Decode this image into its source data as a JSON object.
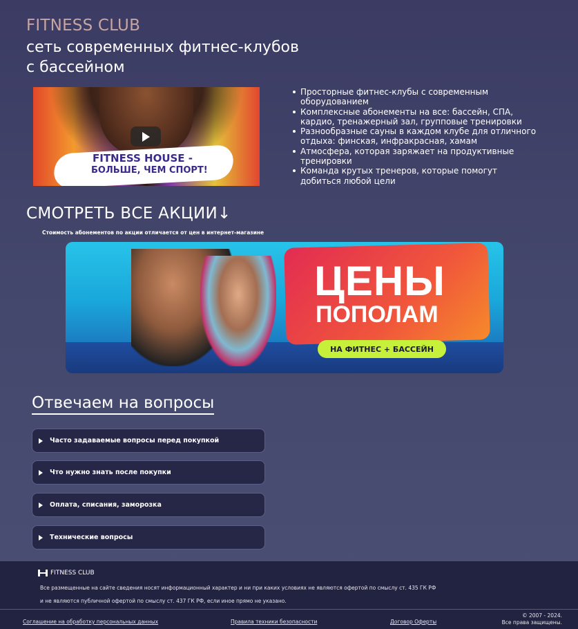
{
  "header": {
    "brand": "FITNESS CLUB",
    "headline_line1": "сеть современных фитнес-клубов",
    "headline_line2": "с бассейном"
  },
  "video": {
    "caption_line1": "FITNESS HOUSE -",
    "caption_line2": "БОЛЬШЕ, ЧЕМ СПОРТ!"
  },
  "benefits": [
    "Просторные фитнес-клубы с современным оборудованием",
    "Комплексные абонементы на все: бассейн, СПА, кардио, тренажерный зал, групповые тренировки",
    "Разнообразные сауны в каждом клубе для отличного отдыха: финская, инфракрасная, хамам",
    "Атмосфера, которая заряжает на продуктивные тренировки",
    "Команда крутых тренеров, которые помогут добиться любой цели"
  ],
  "promo": {
    "title": "СМОТРЕТЬ ВСЕ АКЦИИ↓",
    "note": "Стоимость абонементов по акции отличается от цен в интернет-магазине",
    "banner": {
      "headline1": "ЦЕНЫ",
      "headline2": "ПОПОЛАМ",
      "pill": "НА ФИТНЕС + БАССЕЙН",
      "accent_color": "#e22c52",
      "pill_color": "#c6f03a"
    }
  },
  "faq": {
    "title": "Отвечаем на вопросы",
    "items": [
      "Часто задаваемые вопросы перед покупкой",
      "Что нужно знать после покупки",
      "Оплата, списания, заморозка",
      "Технические вопросы"
    ]
  },
  "footer": {
    "logo_text": "FITNESS CLUB",
    "disclaimer_line1": "Все размещенные на сайте сведения носят информационный характер и ни при каких условиях не являются офертой по смыслу ст. 435 ГК РФ",
    "disclaimer_line2": "и не являются публичной офертой по смыслу ст. 437 ГК РФ, если иное прямо не указано.",
    "links": [
      "Соглашение на обработку персональных данных",
      "Правила техники безопасности",
      "Договор Оферты"
    ],
    "copyright_line1": "© 2007 - 2024.",
    "copyright_line2": "Все права защищены."
  }
}
